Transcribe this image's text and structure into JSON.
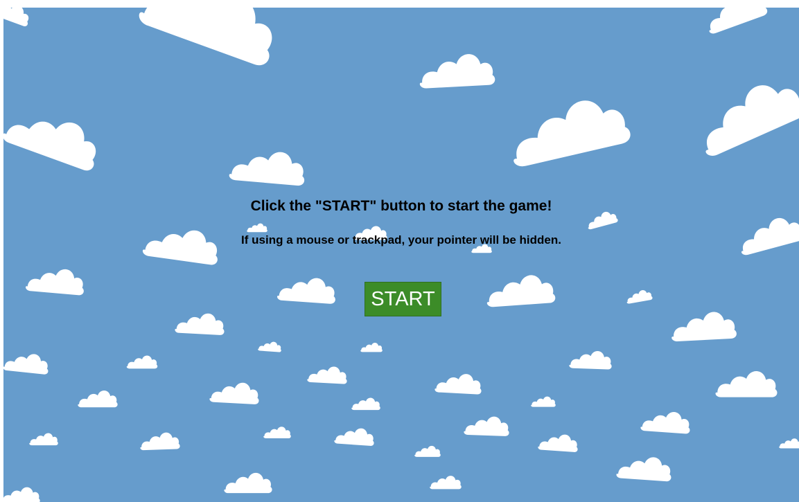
{
  "game": {
    "sky_color": "#669ccc",
    "cloud_color": "#ffffff",
    "instructions": "Click the \"START\" button to start the game!",
    "pointer_note": "If using a mouse or trackpad, your pointer will be hidden.",
    "start_label": "START",
    "start_color": "#3c8c28"
  }
}
